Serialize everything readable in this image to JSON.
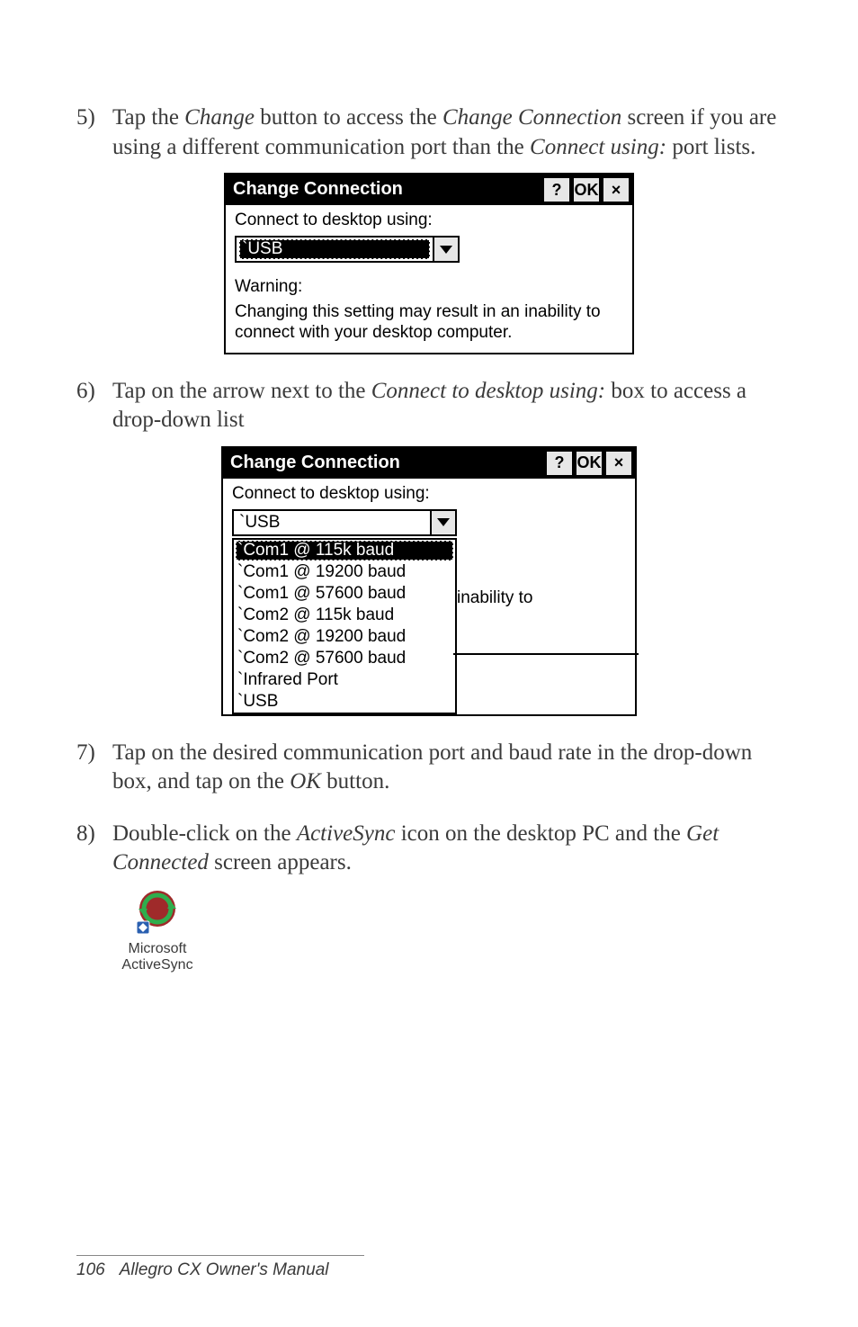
{
  "step5": {
    "num": "5)",
    "text_a": "Tap the ",
    "em1": "Change",
    "text_b": " button to access the ",
    "em2": "Change Connection",
    "text_c": " screen if you are using a different communication port than the ",
    "em3": "Connect using:",
    "text_d": " port lists."
  },
  "dlg1": {
    "title": "Change Connection",
    "help": "?",
    "ok": "OK",
    "close": "×",
    "connect_label": "Connect to desktop using:",
    "selected": "`USB",
    "warning_heading": "Warning:",
    "warning_text": "Changing this setting may result in an inability to connect with your desktop computer."
  },
  "step6": {
    "num": "6)",
    "text_a": "Tap on the arrow next to the ",
    "em1": "Connect to desktop using:",
    "text_b": " box to access a drop-down list"
  },
  "dlg2": {
    "title": "Change Connection",
    "help": "?",
    "ok": "OK",
    "close": "×",
    "connect_label": "Connect to desktop using:",
    "field_value": "`USB",
    "options": [
      "`Com1 @ 115k baud",
      "`Com1 @ 19200 baud",
      "`Com1 @ 57600 baud",
      "`Com2 @ 115k baud",
      "`Com2 @ 19200 baud",
      "`Com2 @ 57600 baud",
      "`Infrared Port",
      "`USB"
    ],
    "selected_index": 0,
    "cut_text": "inability to"
  },
  "step7": {
    "num": "7)",
    "text_a": "Tap on the desired communication port and baud rate in the drop-down box, and tap on the ",
    "em1": "OK",
    "text_b": " button."
  },
  "step8": {
    "num": "8)",
    "text_a": "Double-click on the ",
    "em1": "ActiveSync",
    "text_b": " icon on the desktop PC and the ",
    "em2": "Get Connected",
    "text_c": " screen appears."
  },
  "activesync": {
    "line1": "Microsoft",
    "line2": "ActiveSync"
  },
  "footer": {
    "page_number": "106",
    "book_title": "Allegro CX Owner's Manual"
  }
}
